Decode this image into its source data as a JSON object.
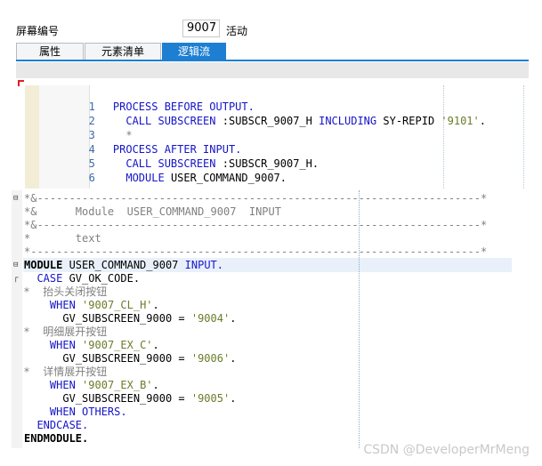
{
  "header": {
    "screen_number_label": "屏幕编号",
    "screen_number_value": "9007",
    "status": "活动"
  },
  "tabs": [
    {
      "label": "属性",
      "active": false
    },
    {
      "label": "元素清单",
      "active": false
    },
    {
      "label": "逻辑流",
      "active": true
    }
  ],
  "flow_logic": {
    "line_numbers": [
      "1",
      "2",
      "3",
      "4",
      "5",
      "6"
    ],
    "lines": [
      {
        "k1": "PROCESS BEFORE OUTPUT."
      },
      {
        "k1": "CALL SUBSCREEN",
        "p1": " :SUBSCR_9007_H ",
        "k2": "INCLUDING",
        "p2": " SY-REPID ",
        "s1": "'9101'",
        "p3": "."
      },
      {
        "c1": "*"
      },
      {
        "k1": "PROCESS AFTER INPUT."
      },
      {
        "k1": "CALL SUBSCREEN",
        "p1": " :SUBSCR_9007_H."
      },
      {
        "k1": "MODULE",
        "p1": " USER_COMMAND_9007."
      }
    ]
  },
  "module_code": {
    "banner": [
      "*&---------------------------------------------------------------------*",
      "*&      Module  USER_COMMAND_9007  INPUT",
      "*&---------------------------------------------------------------------*",
      "*       text",
      "*----------------------------------------------------------------------*"
    ],
    "module_kw": "MODULE",
    "module_name": " USER_COMMAND_9007 ",
    "module_input": "INPUT.",
    "case_kw": "CASE",
    "case_rest": " GV_OK_CODE.",
    "comments": [
      "*    抬头关闭按钮",
      "*    明细展开按钮",
      "*    详情展开按钮"
    ],
    "when_kw": "WHEN",
    "whens": [
      "'9007_CL_H'",
      "'9007_EX_C'",
      "'9007_EX_B'"
    ],
    "period": ".",
    "assign_prefix": "GV_SUBSCREEN_9000 = ",
    "values": [
      "'9004'",
      "'9006'",
      "'9005'"
    ],
    "when_others": "WHEN OTHERS.",
    "endcase": "ENDCASE.",
    "endmodule": "ENDMODULE."
  },
  "watermark": "CSDN @DeveloperMrMeng",
  "colors": {
    "keyword": "#1515c8",
    "string": "#6a7c2a",
    "comment": "#808080",
    "tab_active": "#1d7fd2"
  }
}
